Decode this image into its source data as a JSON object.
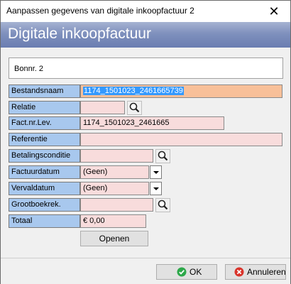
{
  "window": {
    "title": "Aanpassen gegevens van digitale inkoopfactuur 2",
    "close_glyph": "✕"
  },
  "header": {
    "title": "Digitale inkoopfactuur"
  },
  "bonnr": "Bonnr. 2",
  "fields": {
    "bestandsnaam": {
      "label": "Bestandsnaam",
      "value": "1174_1501023_2461665739"
    },
    "relatie": {
      "label": "Relatie",
      "value": ""
    },
    "factnr": {
      "label": "Fact.nr.Lev.",
      "value": "1174_1501023_2461665"
    },
    "referentie": {
      "label": "Referentie",
      "value": ""
    },
    "betalingsconditie": {
      "label": "Betalingsconditie",
      "value": ""
    },
    "factuurdatum": {
      "label": "Factuurdatum",
      "value": "(Geen)"
    },
    "vervaldatum": {
      "label": "Vervaldatum",
      "value": "(Geen)"
    },
    "grootboekrek": {
      "label": "Grootboekrek.",
      "value": ""
    },
    "totaal": {
      "label": "Totaal",
      "value": "€ 0,00"
    }
  },
  "buttons": {
    "openen": "Openen",
    "ok": "OK",
    "annuleren": "Annuleren"
  },
  "colors": {
    "label_bg": "#a8c8ee",
    "field_bg": "#f8dcdc",
    "highlight_bg": "#f8c099",
    "header_bg": "#7f90bd",
    "ok_green": "#2da84a",
    "cancel_red": "#d9342b"
  },
  "icons": {
    "lookup": "magnifier-icon",
    "dropdown": "chevron-down-icon",
    "ok": "check-circle-icon",
    "cancel": "cancel-circle-icon"
  }
}
